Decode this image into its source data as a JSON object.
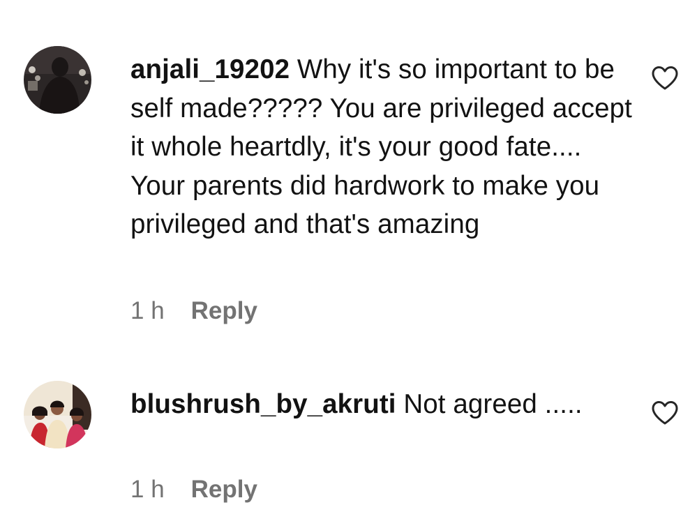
{
  "comments": [
    {
      "username": "anjali_19202",
      "text": "Why it's so important to be self made????? You are privileged accept it whole heartdly, it's your good fate.... Your parents did hardwork to make you privileged and that's amazing",
      "time": "1 h",
      "reply_label": "Reply",
      "like_icon": "heart-outline-icon"
    },
    {
      "username": "blushrush_by_akruti",
      "text": "Not agreed .....",
      "time": "1 h",
      "reply_label": "Reply",
      "like_icon": "heart-outline-icon"
    }
  ],
  "colors": {
    "text": "#121212",
    "secondary_text": "#737373",
    "background": "#ffffff"
  }
}
